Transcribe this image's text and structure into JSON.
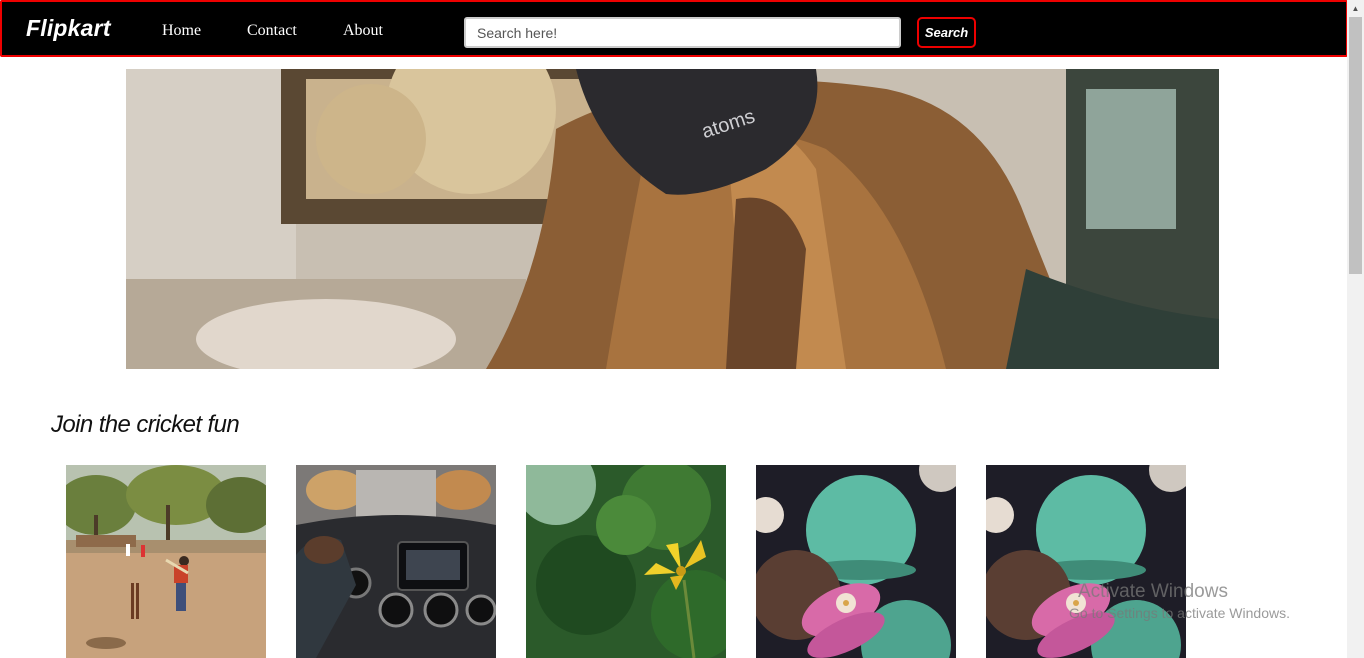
{
  "navbar": {
    "brand": "Flipkart",
    "links": [
      "Home",
      "Contact",
      "About"
    ],
    "search_placeholder": "Search here!",
    "search_button": "Search"
  },
  "hero": {
    "cap_text": "atoms"
  },
  "section": {
    "title": "Join the cricket fun"
  },
  "cards": [
    {
      "subject": "cricket-match"
    },
    {
      "subject": "car-dashboard"
    },
    {
      "subject": "yellow-flower"
    },
    {
      "subject": "macarons"
    },
    {
      "subject": "macarons"
    }
  ],
  "watermark": {
    "title": "Activate Windows",
    "subtitle": "Go to Settings to activate Windows."
  },
  "colors": {
    "nav_bg": "#000000",
    "accent": "#ee0000"
  }
}
